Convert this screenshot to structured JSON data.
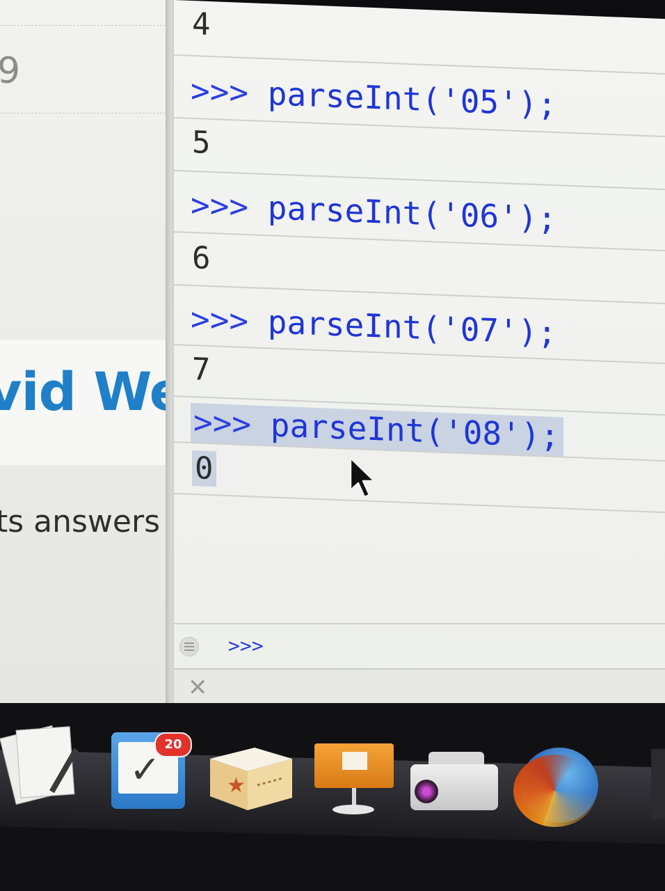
{
  "webpage": {
    "partial_digit": "9",
    "heading": "vid Wer",
    "body_snippet": "ts answers"
  },
  "console": {
    "prompt": ">>>",
    "entries": [
      {
        "result": "4"
      },
      {
        "command": "parseInt('05');",
        "result": "5"
      },
      {
        "command": "parseInt('06');",
        "result": "6"
      },
      {
        "command": "parseInt('07');",
        "result": "7"
      },
      {
        "command": "parseInt('08');",
        "result": "0",
        "highlighted": true
      }
    ],
    "input": {
      "prompt": ">>>",
      "value": ""
    }
  },
  "dock": {
    "items": [
      {
        "name": "preview",
        "icon": "papers-icon"
      },
      {
        "name": "tasks",
        "icon": "checkbox-icon",
        "badge": "20"
      },
      {
        "name": "box-app",
        "icon": "box-icon"
      },
      {
        "name": "presentation",
        "icon": "presentation-icon"
      },
      {
        "name": "projector",
        "icon": "projector-icon"
      },
      {
        "name": "firefox",
        "icon": "firefox-icon"
      }
    ]
  },
  "colors": {
    "command_text": "#1f35d6",
    "result_text": "#2c2c2c",
    "highlight": "#c9d3e2",
    "heading_blue": "#1f7fc8",
    "badge_red": "#e2322c"
  }
}
